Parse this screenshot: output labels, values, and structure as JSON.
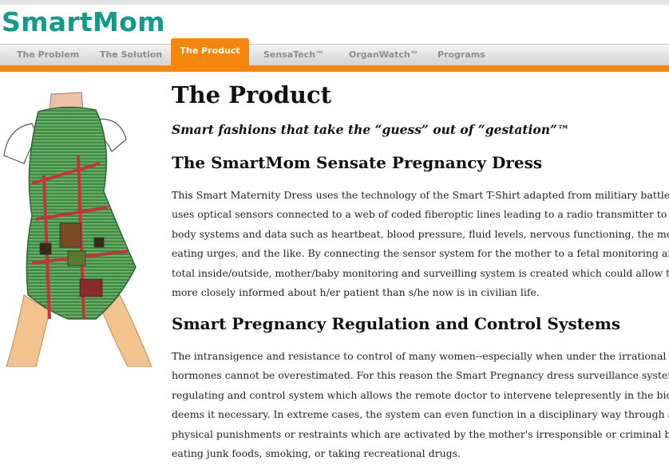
{
  "site": {
    "logo": "SmartMom"
  },
  "nav": {
    "items": [
      {
        "label": "The Problem"
      },
      {
        "label": "The Solution"
      },
      {
        "label": "The Product",
        "active": true
      },
      {
        "label": "SensaTech™"
      },
      {
        "label": "OrganWatch™"
      },
      {
        "label": "Programs"
      }
    ]
  },
  "colors": {
    "brand": "#129b8a",
    "accent": "#f7860d",
    "nav_text": "#8c8c8c"
  },
  "main": {
    "title": "The Product",
    "tagline": "Smart fashions that take the “guess” out of “gestation”™",
    "sections": [
      {
        "heading": "The SmartMom Sensate Pregnancy Dress",
        "lines": [
          "This Smart Maternity Dress uses the technology of the Smart T-Shirt adapted from militiary battlefie",
          "uses optical sensors connected to a web of coded fiberoptic lines leading to a radio transmitter to prov",
          "body systems and data such as heartbeat, blood pressure, fluid levels, nervous functioning, the mothe",
          "eating urges, and the like. By connecting the sensor system for the mother to a fetal monitoring and ir",
          "total inside/outside, mother/baby monitoring and surveilling system is created which could allow the",
          "more closely informed about h/er patient than s/he now is in civilian life."
        ]
      },
      {
        "heading": "Smart Pregnancy Regulation and Control Systems",
        "lines": [
          "The intransigence and resistance to control of many women--especially when under the irrational infl",
          "hormones cannot be overestimated. For this reason the Smart Pregnancy dress surveillance system is",
          "regulating and control system which allows the remote doctor to intervene telepresently in the biolog",
          "deems it necessary. In extreme cases, the system can even function in a disciplinary way through a sy",
          "physical punishments or restraints which are activated by the mother's irresponsible or criminal beha",
          "eating junk foods, smoking, or taking recreational drugs."
        ]
      }
    ]
  }
}
